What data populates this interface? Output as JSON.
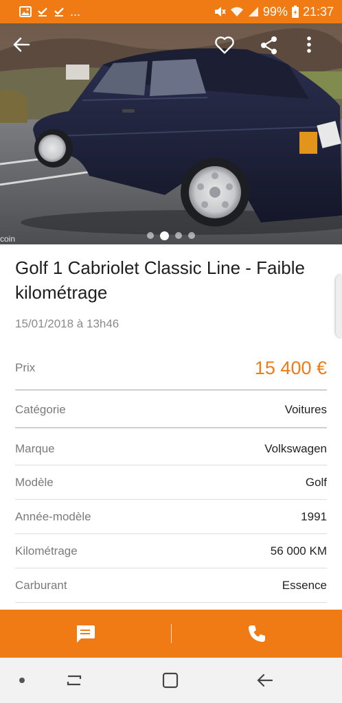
{
  "status_bar": {
    "left_icons": [
      "image-icon",
      "download-done-icon",
      "download-done-icon"
    ],
    "overflow": "...",
    "battery": "99%",
    "time": "21:37"
  },
  "photo": {
    "watermark": "coin",
    "slide_count": 4,
    "active_slide_index": 1
  },
  "listing": {
    "title": "Golf 1 Cabriolet Classic Line - Faible kilométrage",
    "date": "15/01/2018 à 13h46",
    "price_label": "Prix",
    "price_value": "15 400 €",
    "attributes": [
      {
        "label": "Catégorie",
        "value": "Voitures"
      },
      {
        "label": "Marque",
        "value": "Volkswagen"
      },
      {
        "label": "Modèle",
        "value": "Golf"
      },
      {
        "label": "Année-modèle",
        "value": "1991"
      },
      {
        "label": "Kilométrage",
        "value": "56 000 KM"
      },
      {
        "label": "Carburant",
        "value": "Essence"
      }
    ]
  },
  "actions": {
    "message_icon": "chat-bubble-icon",
    "call_icon": "phone-icon"
  },
  "colors": {
    "accent": "#f07a14",
    "nav_bar": "#f2f2f2"
  }
}
